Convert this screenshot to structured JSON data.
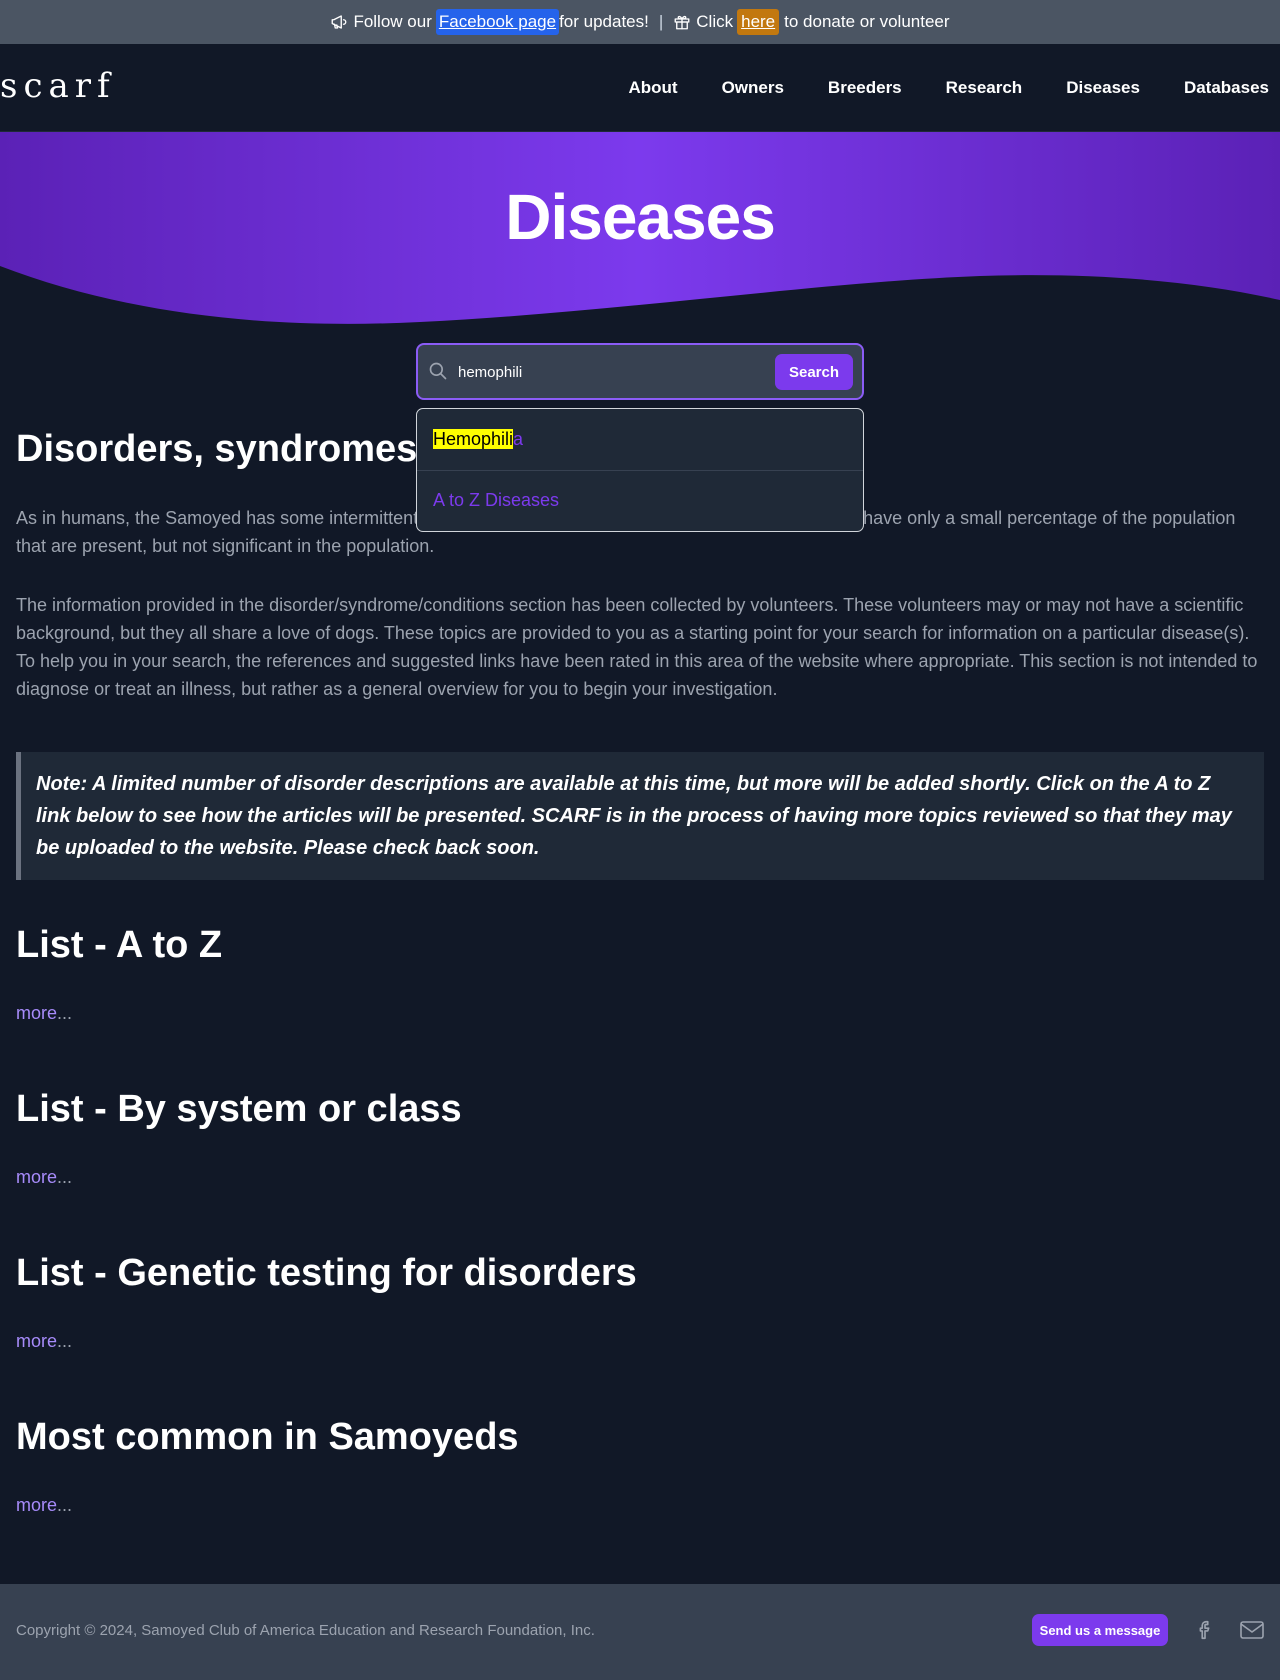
{
  "announcement": {
    "megaphone_icon": "megaphone-icon",
    "follow_text": "Follow our",
    "facebook_link": "Facebook page",
    "updates_text": "for updates!",
    "separator": "|",
    "gift_icon": "gift-icon",
    "click_text": "Click",
    "here_link": "here",
    "donate_text": "to donate or volunteer"
  },
  "nav": {
    "logo": "scarf",
    "items": [
      "About",
      "Owners",
      "Breeders",
      "Research",
      "Diseases",
      "Databases"
    ]
  },
  "hero": {
    "title": "Diseases"
  },
  "search": {
    "value": "hemophili",
    "button_label": "Search",
    "suggestions": {
      "first_match": "Hemophili",
      "first_rest": "a",
      "second": "A to Z Diseases"
    }
  },
  "main": {
    "heading": "Disorders, syndromes and conditions",
    "para1": "As in humans, the Samoyed has some intermittent health issues. Some of these are hereditary, and some have only a small percentage of the population that are present, but not significant in the population.",
    "para2": "The information provided in the disorder/syndrome/conditions section has been collected by volunteers. These volunteers may or may not have a scientific background, but they all share a love of dogs. These topics are provided to you as a starting point for your search for information on a particular disease(s). To help you in your search, the references and suggested links have been rated in this area of the website where appropriate. This section is not intended to diagnose or treat an illness, but rather as a general overview for you to begin your investigation.",
    "note_label": "Note:",
    "note_text": "A limited number of disorder descriptions are available at this time, but more will be added shortly. Click on the A to Z link below to see how the articles will be presented. SCARF is in the process of having more topics reviewed so that they may be uploaded to the website. Please check back soon.",
    "sections": [
      {
        "title": "List - A to Z",
        "more": "more",
        "ellipsis": "..."
      },
      {
        "title": "List - By system or class",
        "more": "more",
        "ellipsis": "..."
      },
      {
        "title": "List - Genetic testing for disorders",
        "more": "more",
        "ellipsis": "..."
      },
      {
        "title": "Most common in Samoyeds",
        "more": "more",
        "ellipsis": "..."
      }
    ]
  },
  "footer": {
    "copyright": "Copyright © 2024, Samoyed Club of America Education and Research Foundation, Inc.",
    "message_button": "Send us a message",
    "facebook_icon": "facebook-icon",
    "mail_icon": "mail-icon"
  },
  "colors": {
    "background": "#111827",
    "accent": "#7c3aed",
    "link": "#a78bfa",
    "topbar": "#4b5563",
    "facebook_highlight": "#2563eb",
    "donate_highlight": "#c2780f",
    "search_highlight": "#ffff00"
  }
}
